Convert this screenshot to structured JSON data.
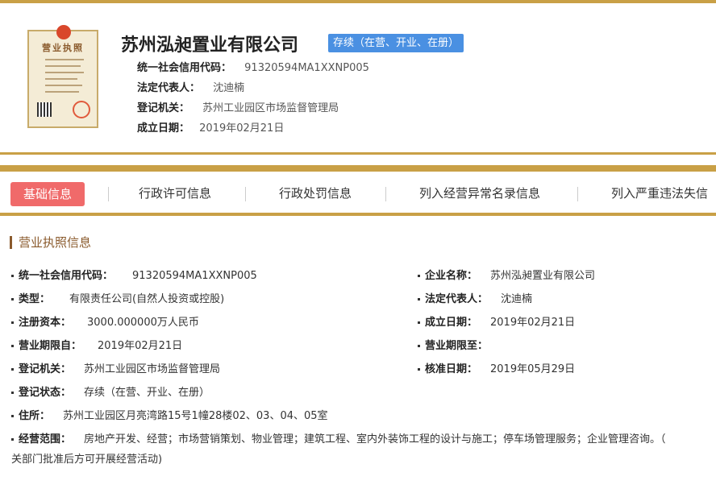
{
  "header": {
    "company_name": "苏州泓昶置业有限公司",
    "status": "存续（在营、开业、在册）",
    "license_title": "营业执照",
    "fields": [
      {
        "label": "统一社会信用代码：",
        "value": "91320594MA1XXNP005"
      },
      {
        "label": "法定代表人：",
        "value": "沈迪楠"
      },
      {
        "label": "登记机关：",
        "value": "苏州工业园区市场监督管理局"
      },
      {
        "label": "成立日期：",
        "value": "2019年02月21日"
      }
    ]
  },
  "tabs": [
    {
      "label": "基础信息",
      "active": true
    },
    {
      "label": "行政许可信息",
      "active": false
    },
    {
      "label": "行政处罚信息",
      "active": false
    },
    {
      "label": "列入经营异常名录信息",
      "active": false
    },
    {
      "label": "列入严重违法失信"
    }
  ],
  "section": {
    "title": "营业执照信息",
    "left": [
      {
        "label": "统一社会信用代码：",
        "value": "91320594MA1XXNP005"
      },
      {
        "label": "类型：",
        "value": "有限责任公司(自然人投资或控股)"
      },
      {
        "label": "注册资本：",
        "value": "3000.000000万人民币"
      },
      {
        "label": "营业期限自：",
        "value": "2019年02月21日"
      },
      {
        "label": "登记机关：",
        "value": "苏州工业园区市场监督管理局"
      },
      {
        "label": "登记状态：",
        "value": "存续（在营、开业、在册）"
      }
    ],
    "right": [
      {
        "label": "企业名称：",
        "value": "苏州泓昶置业有限公司"
      },
      {
        "label": "法定代表人：",
        "value": "沈迪楠"
      },
      {
        "label": "成立日期：",
        "value": "2019年02月21日"
      },
      {
        "label": "营业期限至：",
        "value": ""
      },
      {
        "label": "核准日期：",
        "value": "2019年05月29日"
      }
    ],
    "address": {
      "label": "住所：",
      "value": "苏州工业园区月亮湾路15号1幢28楼02、03、04、05室"
    },
    "scope": {
      "label": "经营范围：",
      "value": "房地产开发、经营；市场营销策划、物业管理；建筑工程、室内外装饰工程的设计与施工；停车场管理服务；企业管理咨询。（",
      "value2": "关部门批准后方可开展经营活动)"
    }
  },
  "colors": {
    "gold": "#c9a046",
    "active_tab": "#f06a6a",
    "status_badge": "#4a90e2"
  }
}
